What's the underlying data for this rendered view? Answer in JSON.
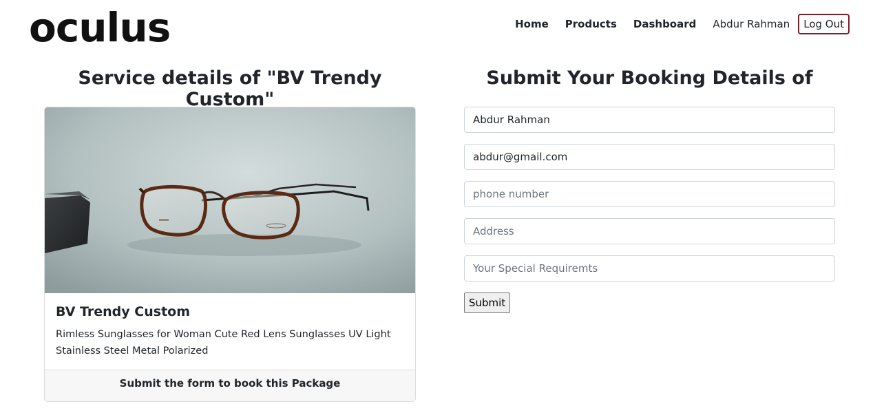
{
  "brand": {
    "logo_text": "oculus"
  },
  "nav": {
    "home": "Home",
    "products": "Products",
    "dashboard": "Dashboard",
    "user_name": "Abdur Rahman",
    "logout": "Log Out"
  },
  "details": {
    "heading": "Service details of \"BV Trendy Custom\"",
    "card_title": "BV Trendy Custom",
    "card_description": "Rimless Sunglasses for Woman Cute Red Lens Sunglasses UV Light Stainless Steel Metal Polarized",
    "card_footer": "Submit the form to book this Package"
  },
  "booking": {
    "heading": "Submit Your Booking Details of",
    "name_value": "Abdur Rahman",
    "email_value": "abdur@gmail.com",
    "phone_placeholder": "phone number",
    "address_placeholder": "Address",
    "requirements_placeholder": "Your Special Requiremts",
    "submit_label": "Submit"
  },
  "colors": {
    "logout_border": "#7a1f2b",
    "footer_bg": "#f7f7f7"
  }
}
